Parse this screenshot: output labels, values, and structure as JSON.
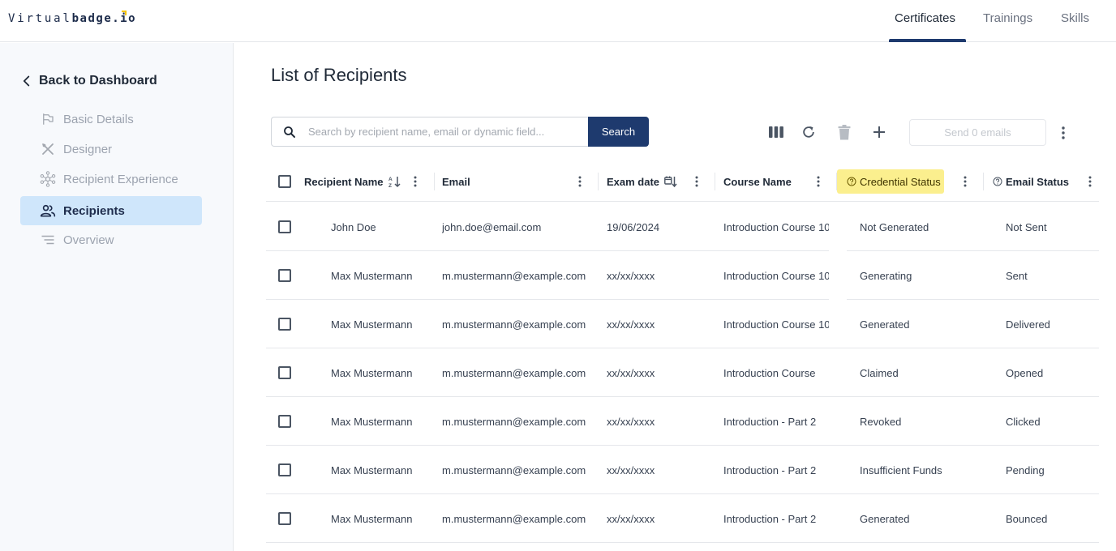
{
  "brand": {
    "logo_thin": "Virtual",
    "logo_bold": "badge.io"
  },
  "topnav": {
    "items": [
      "Certificates",
      "Trainings",
      "Skills"
    ],
    "active": "Certificates"
  },
  "sidebar": {
    "back_label": "Back to Dashboard",
    "items": [
      {
        "label": "Basic Details",
        "icon": "flag-outline-icon",
        "active": false
      },
      {
        "label": "Designer",
        "icon": "design-tools-icon",
        "active": false
      },
      {
        "label": "Recipient Experience",
        "icon": "hub-network-icon",
        "active": false
      },
      {
        "label": "Recipients",
        "icon": "people-icon",
        "active": true
      },
      {
        "label": "Overview",
        "icon": "list-lines-icon",
        "active": false
      }
    ]
  },
  "main": {
    "title": "List of Recipients",
    "search": {
      "placeholder": "Search by recipient name, email or dynamic field...",
      "value": "",
      "button_label": "Search"
    },
    "toolbar": {
      "icons": [
        "columns-icon",
        "refresh-icon",
        "delete-icon",
        "add-icon"
      ],
      "send_label": "Send 0 emails",
      "more_icon": "more-vertical-icon"
    },
    "table": {
      "columns": [
        "Recipient Name",
        "Email",
        "Exam date",
        "Course Name",
        "Credential Status",
        "Email Status"
      ],
      "highlighted_column": "Credential Status",
      "rows": [
        {
          "name": "John Doe",
          "email": "john.doe@email.com",
          "date": "19/06/2024",
          "course": "Introduction Course 10",
          "credential": "Not Generated",
          "email_status": "Not Sent"
        },
        {
          "name": "Max Mustermann",
          "email": "m.mustermann@example.com",
          "date": "xx/xx/xxxx",
          "course": "Introduction Course 10",
          "credential": "Generating",
          "email_status": "Sent"
        },
        {
          "name": "Max Mustermann",
          "email": "m.mustermann@example.com",
          "date": "xx/xx/xxxx",
          "course": "Introduction Course 10",
          "credential": "Generated",
          "email_status": "Delivered"
        },
        {
          "name": "Max Mustermann",
          "email": "m.mustermann@example.com",
          "date": "xx/xx/xxxx",
          "course": "Introduction Course",
          "credential": "Claimed",
          "email_status": "Opened"
        },
        {
          "name": "Max Mustermann",
          "email": "m.mustermann@example.com",
          "date": "xx/xx/xxxx",
          "course": "Introduction - Part 2",
          "credential": "Revoked",
          "email_status": "Clicked"
        },
        {
          "name": "Max Mustermann",
          "email": "m.mustermann@example.com",
          "date": "xx/xx/xxxx",
          "course": "Introduction - Part 2",
          "credential": "Insufficient Funds",
          "email_status": "Pending"
        },
        {
          "name": "Max Mustermann",
          "email": "m.mustermann@example.com",
          "date": "xx/xx/xxxx",
          "course": "Introduction - Part 2",
          "credential": "Generated",
          "email_status": "Bounced"
        }
      ]
    }
  },
  "colors": {
    "primary": "#1e3a6e",
    "active_bg": "#cfe6fb",
    "highlight": "#fbef8e"
  }
}
